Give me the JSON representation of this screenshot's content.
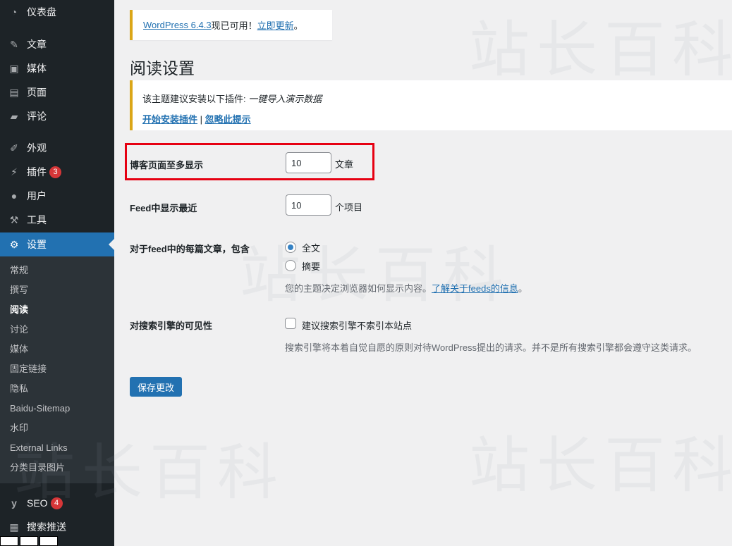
{
  "sidebar": {
    "menu": [
      {
        "label": "仪表盘",
        "icon": "dashboard-icon",
        "glyph": "◔"
      },
      {
        "label": "文章",
        "icon": "pin-icon",
        "glyph": "✎"
      },
      {
        "label": "媒体",
        "icon": "media-icon",
        "glyph": "▣"
      },
      {
        "label": "页面",
        "icon": "page-icon",
        "glyph": "▤"
      },
      {
        "label": "评论",
        "icon": "comment-icon",
        "glyph": "▰"
      },
      {
        "label": "外观",
        "icon": "brush-icon",
        "glyph": "✐"
      },
      {
        "label": "插件",
        "icon": "plugin-icon",
        "glyph": "⚡",
        "badge": "3"
      },
      {
        "label": "用户",
        "icon": "user-icon",
        "glyph": "●"
      },
      {
        "label": "工具",
        "icon": "wrench-icon",
        "glyph": "⚒"
      },
      {
        "label": "设置",
        "icon": "settings-icon",
        "glyph": "⚙"
      }
    ],
    "submenu": [
      "常规",
      "撰写",
      "阅读",
      "讨论",
      "媒体",
      "固定链接",
      "隐私",
      "Baidu-Sitemap",
      "水印",
      "External Links",
      "分类目录图片"
    ],
    "submenu_current": "阅读",
    "bottom_menu": [
      {
        "label": "SEO",
        "icon": "yoast-icon",
        "glyph": "y",
        "badge": "4"
      },
      {
        "label": "搜索推送",
        "icon": "push-icon",
        "glyph": "▦"
      }
    ]
  },
  "watermark": "站长百科",
  "update_notice": {
    "link": "WordPress 6.4.3",
    "text": "现已可用！",
    "action": "立即更新",
    "end": "。"
  },
  "page_title": "阅读设置",
  "plugin_notice": {
    "text": "该主题建议安装以下插件: ",
    "plugin": "一键导入演示数据",
    "install_link": "开始安装插件",
    "separator": "|",
    "dismiss_link": "忽略此提示"
  },
  "settings": {
    "posts_per_page": {
      "label": "博客页面至多显示",
      "value": "10",
      "suffix": "文章"
    },
    "feed_recent": {
      "label": "Feed中显示最近",
      "value": "10",
      "suffix": "个项目"
    },
    "feed_content": {
      "label": "对于feed中的每篇文章，包含",
      "options": [
        "全文",
        "摘要"
      ],
      "selected": "全文",
      "desc": "您的主题决定浏览器如何显示内容。",
      "desc_link": "了解关于feeds的信息",
      "desc_end": "。"
    },
    "search_visibility": {
      "label": "对搜索引擎的可见性",
      "checkbox_label": "建议搜索引擎不索引本站点",
      "checked": false,
      "desc": "搜索引擎将本着自觉自愿的原则对待WordPress提出的请求。并不是所有搜索引擎都会遵守这类请求。"
    }
  },
  "save_button": "保存更改",
  "colors": {
    "accent": "#2271b1",
    "warning": "#dba617",
    "highlight": "#e60012",
    "badge": "#d63638"
  }
}
